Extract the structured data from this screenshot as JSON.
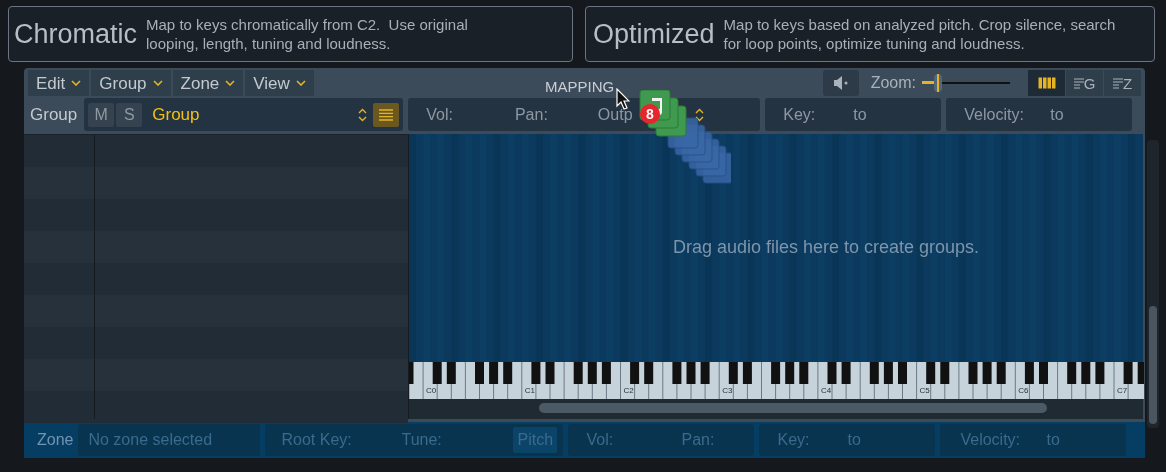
{
  "mode_buttons": [
    {
      "title": "Chromatic",
      "description": "Map to keys chromatically from C2.  Use original looping, length, tuning and loudness."
    },
    {
      "title": "Optimized",
      "description": "Map to keys based on analyzed pitch. Crop silence, search for loop points, optimize tuning and loudness."
    }
  ],
  "menus": [
    {
      "label": "Edit"
    },
    {
      "label": "Group"
    },
    {
      "label": "Zone"
    },
    {
      "label": "View"
    }
  ],
  "title": "MAPPING",
  "zoom": {
    "label": "Zoom:",
    "level": 0.18
  },
  "view_buttons": [
    {
      "kind": "keyboard",
      "selected": true
    },
    {
      "kind": "group",
      "letter": "G",
      "selected": false
    },
    {
      "kind": "zone",
      "letter": "Z",
      "selected": false
    }
  ],
  "group_bar": {
    "label": "Group",
    "mute": "M",
    "solo": "S",
    "name": "Group",
    "list_on": true
  },
  "group_params": [
    "Vol:",
    "Pan:",
    "Outp"
  ],
  "key_range": {
    "label": "Key:",
    "to": "to"
  },
  "velocity_range": {
    "label": "Velocity:",
    "to": "to"
  },
  "mapping": {
    "hint": "Drag audio files here to create groups.",
    "octave_labels": [
      "C0",
      "C1",
      "C2",
      "C3",
      "C4",
      "C5",
      "C6",
      "C7"
    ]
  },
  "drag": {
    "count": "8"
  },
  "zone_bar": {
    "label": "Zone",
    "selection": "No zone selected",
    "root_key": "Root Key:",
    "tune": "Tune:",
    "pitch": "Pitch",
    "vol": "Vol:",
    "pan": "Pan:",
    "key": "Key:",
    "key_to": "to",
    "velocity": "Velocity:",
    "velocity_to": "to"
  }
}
